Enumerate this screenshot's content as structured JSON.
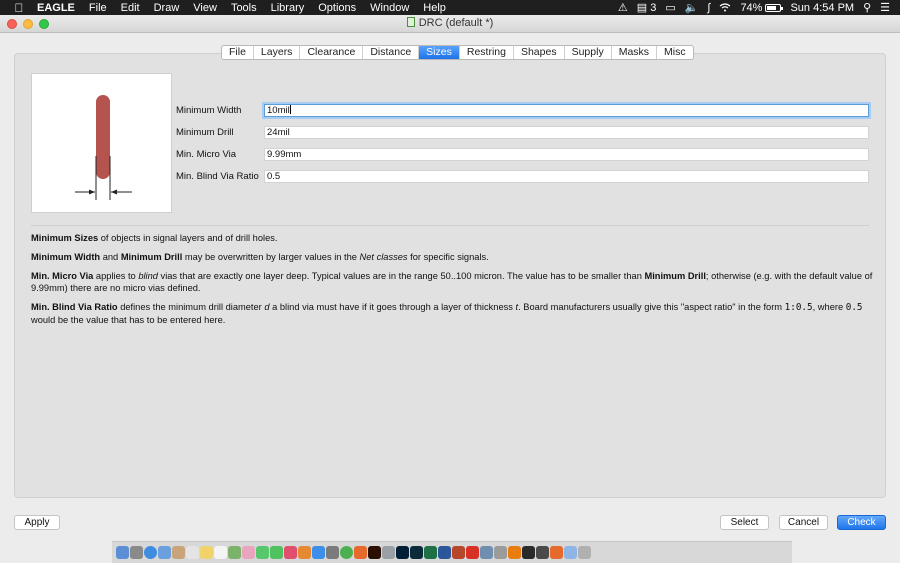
{
  "menubar": {
    "apple_icon": "apple-icon",
    "app_name": "EAGLE",
    "items": [
      "File",
      "Edit",
      "Draw",
      "View",
      "Tools",
      "Library",
      "Options",
      "Window",
      "Help"
    ],
    "status": {
      "notification_count": "3",
      "battery": "74%",
      "clock": "Sun 4:54 PM"
    }
  },
  "window": {
    "title": "DRC (default *)"
  },
  "tabs": [
    "File",
    "Layers",
    "Clearance",
    "Distance",
    "Sizes",
    "Restring",
    "Shapes",
    "Supply",
    "Masks",
    "Misc"
  ],
  "active_tab": "Sizes",
  "fields": [
    {
      "label": "Minimum Width",
      "value": "10mil"
    },
    {
      "label": "Minimum Drill",
      "value": "24mil"
    },
    {
      "label": "Min. Micro Via",
      "value": "9.99mm"
    },
    {
      "label": "Min. Blind Via Ratio",
      "value": "0.5"
    }
  ],
  "help": {
    "p1": {
      "b1": "Minimum Sizes",
      "t1": " of objects in signal layers and of drill holes."
    },
    "p2": {
      "b1": "Minimum Width",
      "t1": " and ",
      "b2": "Minimum Drill",
      "t2": " may be overwritten by larger values in the ",
      "i1": "Net classes",
      "t3": " for specific signals."
    },
    "p3": {
      "b1": "Min. Micro Via",
      "t1": " applies to ",
      "i1": "blind",
      "t2": " vias that are exactly one layer deep. Typical values are in the range 50..100 micron. The value has to be smaller than ",
      "b2": "Minimum Drill",
      "t3": "; otherwise (e.g. with the default value of 9.99mm) there are no micro vias defined."
    },
    "p4": {
      "b1": "Min. Blind Via Ratio",
      "t1": " defines the minimum drill diameter ",
      "i1": "d",
      "t2": " a blind via must have if it goes through a layer of thickness ",
      "i2": "t",
      "t3": ". Board manufacturers usually give this \"aspect ratio\" in the form ",
      "m1": "1:0.5",
      "t4": ", where ",
      "m2": "0.5",
      "t5": " would be the value that has to be entered here."
    }
  },
  "buttons": {
    "apply": "Apply",
    "select": "Select",
    "cancel": "Cancel",
    "check": "Check"
  },
  "colors": {
    "accent": "#1d72e8",
    "trace": "#b5534f"
  },
  "dock_icons": [
    "finder",
    "launchpad",
    "safari",
    "mail",
    "contacts",
    "calendar",
    "notes",
    "reminders",
    "maps",
    "photos",
    "messages",
    "facetime",
    "itunes",
    "ibooks",
    "app-store",
    "system-preferences",
    "chrome",
    "firefox",
    "illustrator",
    "help",
    "photoshop",
    "lightroom",
    "excel",
    "word",
    "powerpoint",
    "pdf",
    "preview",
    "misc",
    "blender",
    "terminal",
    "activity",
    "eagle",
    "folder",
    "trash"
  ]
}
